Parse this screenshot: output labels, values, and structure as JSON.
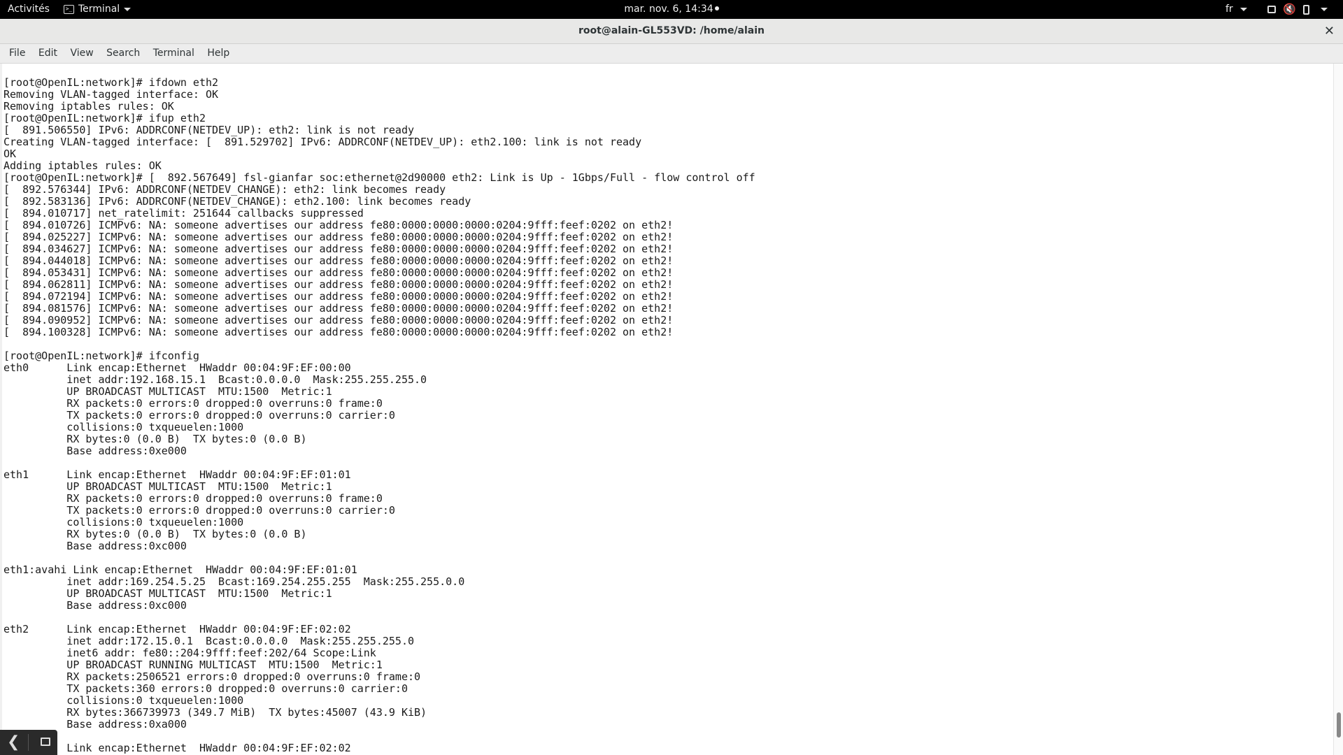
{
  "topbar": {
    "activities": "Activités",
    "app_menu": "Terminal",
    "clock": "mar. nov.  6, 14:34",
    "language": "fr",
    "icons": [
      "window-icon",
      "speaker-muted-icon",
      "battery-icon",
      "power-menu-icon"
    ]
  },
  "window": {
    "title": "root@alain-GL553VD: /home/alain",
    "close_glyph": "✕"
  },
  "menubar": {
    "items": [
      "File",
      "Edit",
      "View",
      "Search",
      "Terminal",
      "Help"
    ]
  },
  "terminal": {
    "lines": [
      "[root@OpenIL:network]# ifdown eth2",
      "Removing VLAN-tagged interface: OK",
      "Removing iptables rules: OK",
      "[root@OpenIL:network]# ifup eth2",
      "[  891.506550] IPv6: ADDRCONF(NETDEV_UP): eth2: link is not ready",
      "Creating VLAN-tagged interface: [  891.529702] IPv6: ADDRCONF(NETDEV_UP): eth2.100: link is not ready",
      "OK",
      "Adding iptables rules: OK",
      "[root@OpenIL:network]# [  892.567649] fsl-gianfar soc:ethernet@2d90000 eth2: Link is Up - 1Gbps/Full - flow control off",
      "[  892.576344] IPv6: ADDRCONF(NETDEV_CHANGE): eth2: link becomes ready",
      "[  892.583136] IPv6: ADDRCONF(NETDEV_CHANGE): eth2.100: link becomes ready",
      "[  894.010717] net_ratelimit: 251644 callbacks suppressed",
      "[  894.010726] ICMPv6: NA: someone advertises our address fe80:0000:0000:0000:0204:9fff:feef:0202 on eth2!",
      "[  894.025227] ICMPv6: NA: someone advertises our address fe80:0000:0000:0000:0204:9fff:feef:0202 on eth2!",
      "[  894.034627] ICMPv6: NA: someone advertises our address fe80:0000:0000:0000:0204:9fff:feef:0202 on eth2!",
      "[  894.044018] ICMPv6: NA: someone advertises our address fe80:0000:0000:0000:0204:9fff:feef:0202 on eth2!",
      "[  894.053431] ICMPv6: NA: someone advertises our address fe80:0000:0000:0000:0204:9fff:feef:0202 on eth2!",
      "[  894.062811] ICMPv6: NA: someone advertises our address fe80:0000:0000:0000:0204:9fff:feef:0202 on eth2!",
      "[  894.072194] ICMPv6: NA: someone advertises our address fe80:0000:0000:0000:0204:9fff:feef:0202 on eth2!",
      "[  894.081576] ICMPv6: NA: someone advertises our address fe80:0000:0000:0000:0204:9fff:feef:0202 on eth2!",
      "[  894.090952] ICMPv6: NA: someone advertises our address fe80:0000:0000:0000:0204:9fff:feef:0202 on eth2!",
      "[  894.100328] ICMPv6: NA: someone advertises our address fe80:0000:0000:0000:0204:9fff:feef:0202 on eth2!",
      "",
      "[root@OpenIL:network]# ifconfig",
      "eth0      Link encap:Ethernet  HWaddr 00:04:9F:EF:00:00",
      "          inet addr:192.168.15.1  Bcast:0.0.0.0  Mask:255.255.255.0",
      "          UP BROADCAST MULTICAST  MTU:1500  Metric:1",
      "          RX packets:0 errors:0 dropped:0 overruns:0 frame:0",
      "          TX packets:0 errors:0 dropped:0 overruns:0 carrier:0",
      "          collisions:0 txqueuelen:1000",
      "          RX bytes:0 (0.0 B)  TX bytes:0 (0.0 B)",
      "          Base address:0xe000",
      "",
      "eth1      Link encap:Ethernet  HWaddr 00:04:9F:EF:01:01",
      "          UP BROADCAST MULTICAST  MTU:1500  Metric:1",
      "          RX packets:0 errors:0 dropped:0 overruns:0 frame:0",
      "          TX packets:0 errors:0 dropped:0 overruns:0 carrier:0",
      "          collisions:0 txqueuelen:1000",
      "          RX bytes:0 (0.0 B)  TX bytes:0 (0.0 B)",
      "          Base address:0xc000",
      "",
      "eth1:avahi Link encap:Ethernet  HWaddr 00:04:9F:EF:01:01",
      "          inet addr:169.254.5.25  Bcast:169.254.255.255  Mask:255.255.0.0",
      "          UP BROADCAST MULTICAST  MTU:1500  Metric:1",
      "          Base address:0xc000",
      "",
      "eth2      Link encap:Ethernet  HWaddr 00:04:9F:EF:02:02",
      "          inet addr:172.15.0.1  Bcast:0.0.0.0  Mask:255.255.255.0",
      "          inet6 addr: fe80::204:9fff:feef:202/64 Scope:Link",
      "          UP BROADCAST RUNNING MULTICAST  MTU:1500  Metric:1",
      "          RX packets:2506521 errors:0 dropped:0 overruns:0 frame:0",
      "          TX packets:360 errors:0 dropped:0 overruns:0 carrier:0",
      "          collisions:0 txqueuelen:1000",
      "          RX bytes:366739973 (349.7 MiB)  TX bytes:45007 (43.9 KiB)",
      "          Base address:0xa000",
      "",
      "          Link encap:Ethernet  HWaddr 00:04:9F:EF:02:02"
    ]
  }
}
